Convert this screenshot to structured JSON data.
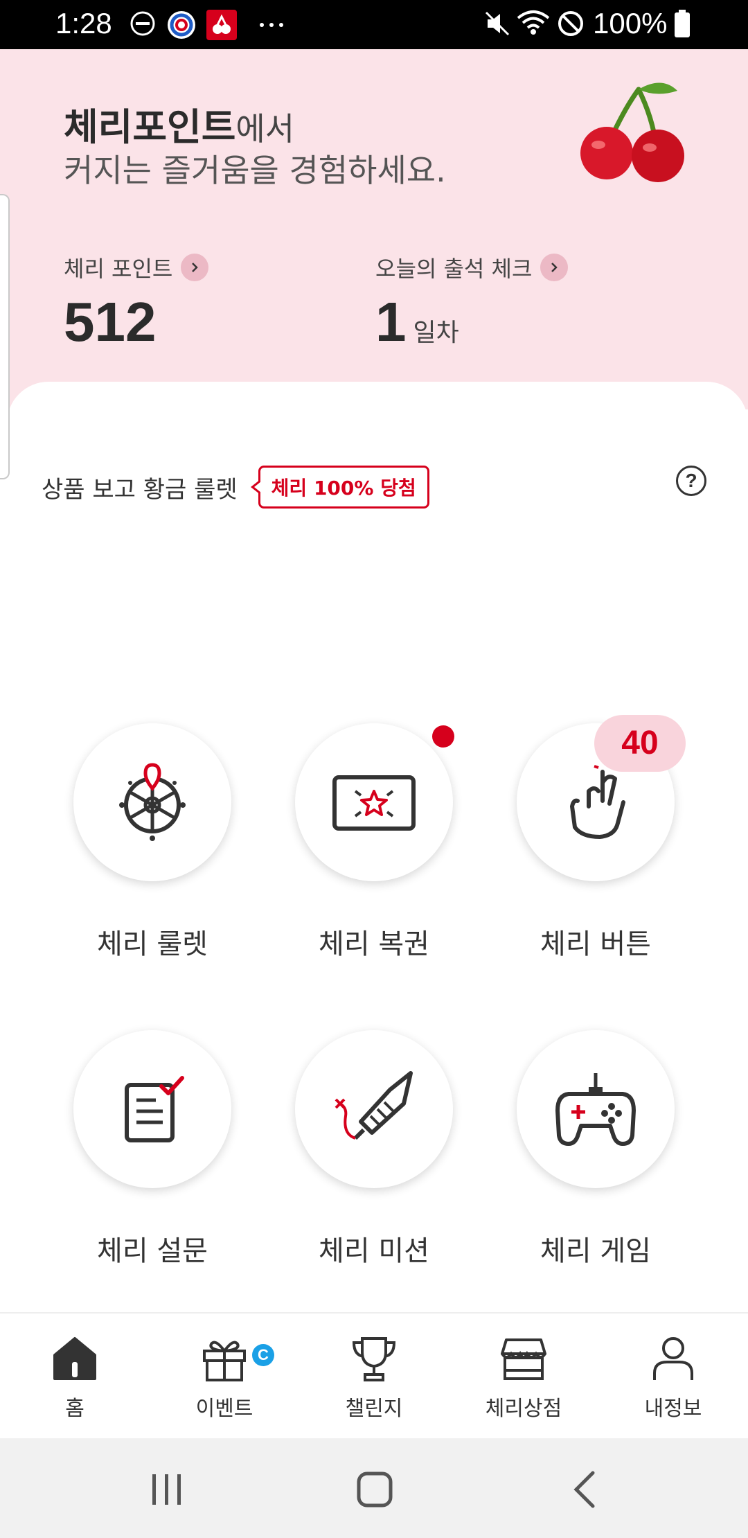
{
  "status_bar": {
    "time": "1:28",
    "battery": "100%"
  },
  "header": {
    "headline_bold": "체리포인트",
    "headline_suffix": "에서",
    "headline_line2": "커지는 즐거움을 경험하세요.",
    "points_label": "체리 포인트",
    "points_value": "512",
    "attendance_label": "오늘의 출석 체크",
    "attendance_value": "1",
    "attendance_unit": "일차"
  },
  "roulette_banner": {
    "text": "상품 보고 황금 룰렛",
    "badge": "체리 100% 당첨",
    "help": "?"
  },
  "menu": [
    {
      "label": "체리 룰렛",
      "icon": "wheel-icon"
    },
    {
      "label": "체리 복권",
      "icon": "lottery-ticket-icon"
    },
    {
      "label": "체리 버튼",
      "icon": "tap-hand-icon",
      "count": "40"
    },
    {
      "label": "체리 설문",
      "icon": "survey-icon"
    },
    {
      "label": "체리 미션",
      "icon": "rocket-icon"
    },
    {
      "label": "체리 게임",
      "icon": "gamepad-icon"
    }
  ],
  "bottom_nav": [
    {
      "label": "홈",
      "icon": "home-icon"
    },
    {
      "label": "이벤트",
      "icon": "gift-icon",
      "badge": "C"
    },
    {
      "label": "챌린지",
      "icon": "trophy-icon"
    },
    {
      "label": "체리상점",
      "icon": "store-icon"
    },
    {
      "label": "내정보",
      "icon": "person-icon"
    }
  ],
  "colors": {
    "accent": "#d6001c",
    "header_bg": "#fbe3e8",
    "count_bg": "#f9d4dc",
    "event_badge": "#1aa0e6"
  }
}
